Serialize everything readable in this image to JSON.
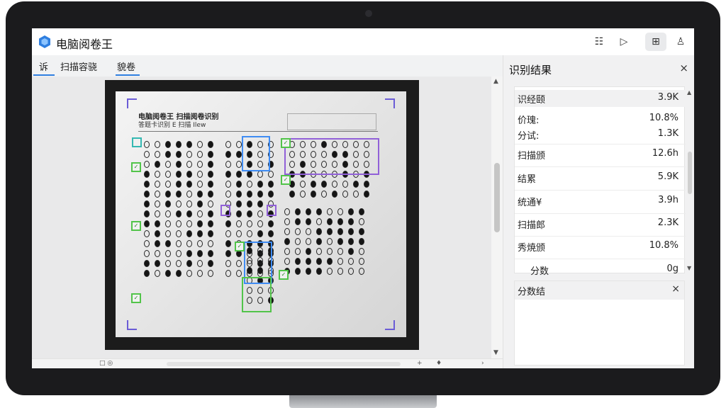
{
  "app": {
    "title": "电脑阅卷王",
    "brand_color": "#2f7fe0"
  },
  "toolbar": {
    "icons": [
      "list-icon",
      "play-icon",
      "layout-icon",
      "user-icon"
    ],
    "list_glyph": "☷",
    "play_glyph": "▷",
    "layout_glyph": "⊞",
    "user_glyph": "♙"
  },
  "tabs": [
    {
      "label": "诉"
    },
    {
      "label": "扫描容骁"
    },
    {
      "label": "貌卷"
    }
  ],
  "document": {
    "header_line1": "电脑阅卷王 扫描阅卷识别",
    "header_line2": "答题卡识别 E 扫描 Ilew"
  },
  "status": {
    "left_glyph": "□ ◎",
    "mid_glyph": "+",
    "pin_glyph": "♦",
    "right_glyph": "›"
  },
  "panel": {
    "title": "识别结果",
    "close_glyph": "×",
    "rows": [
      {
        "label": "识经颐",
        "value": "3.9K"
      },
      {
        "label": "价瑰:",
        "value": "10.8%"
      },
      {
        "label": "分试:",
        "value": "1.3K"
      },
      {
        "label": "扫描颁",
        "value": "12.6h"
      },
      {
        "label": "结累",
        "value": "5.9K"
      },
      {
        "label": "统通¥",
        "value": "3.9h"
      },
      {
        "label": "扫描郎",
        "value": "2.3K"
      },
      {
        "label": "秀焼颁",
        "value": "10.8%"
      },
      {
        "label": "分数",
        "value": "0g"
      }
    ]
  },
  "score_panel": {
    "title": "分数结",
    "close_glyph": "×"
  }
}
